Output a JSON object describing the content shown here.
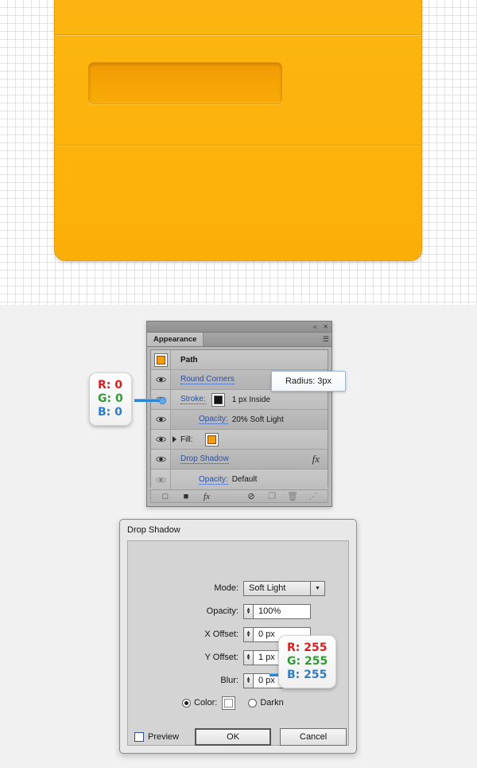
{
  "canvas": {
    "graphic_name": "orange-card-illustration",
    "colors": {
      "card_fill": "#fcb40f",
      "card_stroke": "#e49805",
      "slot_fill": "#f5a504",
      "grid": "#e2e2e2"
    }
  },
  "panel": {
    "collapse_icon": "«",
    "close_icon": "✕",
    "tab_label": "Appearance",
    "menu_icon": "☰",
    "rows": [
      {
        "name": "path",
        "label": "Path",
        "kind": "header",
        "eye": false,
        "swatch": "#f39c12"
      },
      {
        "name": "round-corners",
        "label": "Round Corners",
        "kind": "link",
        "eye": true,
        "value": ""
      },
      {
        "name": "stroke",
        "label": "Stroke:",
        "kind": "link",
        "eye": true,
        "swatch": "#141414",
        "value": "1 px  Inside"
      },
      {
        "name": "stroke-opacity",
        "label": "Opacity:",
        "kind": "link",
        "eye": true,
        "value": "20% Soft Light",
        "indent": true
      },
      {
        "name": "fill",
        "label": "Fill:",
        "kind": "plain",
        "eye": true,
        "swatch": "#f39c12",
        "expandable": true
      },
      {
        "name": "drop-shadow",
        "label": "Drop Shadow",
        "kind": "link",
        "eye": true,
        "fx": "fx"
      },
      {
        "name": "effect-opacity",
        "label": "Opacity:",
        "kind": "link",
        "eye": true,
        "eye_dim": true,
        "value": "Default",
        "indent": true
      }
    ],
    "footer": {
      "add_new_stroke": "□",
      "add_new_fill": "■",
      "add_effect": "fx",
      "clear_appearance": "⊘",
      "duplicate_item": "❐",
      "delete_item": "🗑",
      "resize_grip": "⋰"
    }
  },
  "tooltip": {
    "text": "Radius: 3px"
  },
  "callouts": {
    "stroke_color": {
      "r": "R: 0",
      "g": "G: 0",
      "b": "B: 0"
    },
    "shadow_color": {
      "r": "R: 255",
      "g": "G: 255",
      "b": "B: 255"
    }
  },
  "dialog": {
    "title": "Drop Shadow",
    "fields": {
      "mode_label": "Mode:",
      "mode_value": "Soft Light",
      "mode_arrow": "▼",
      "opacity_label": "Opacity:",
      "opacity_value": "100%",
      "x_offset_label": "X Offset:",
      "x_offset_value": "0 px",
      "y_offset_label": "Y Offset:",
      "y_offset_value": "1 px",
      "blur_label": "Blur:",
      "blur_value": "0 px",
      "color_label": "Color:",
      "darkness_label": "Darkn",
      "spinner_up": "▲",
      "spinner_down": "▼"
    },
    "preview_label": "Preview",
    "ok_label": "OK",
    "cancel_label": "Cancel"
  }
}
